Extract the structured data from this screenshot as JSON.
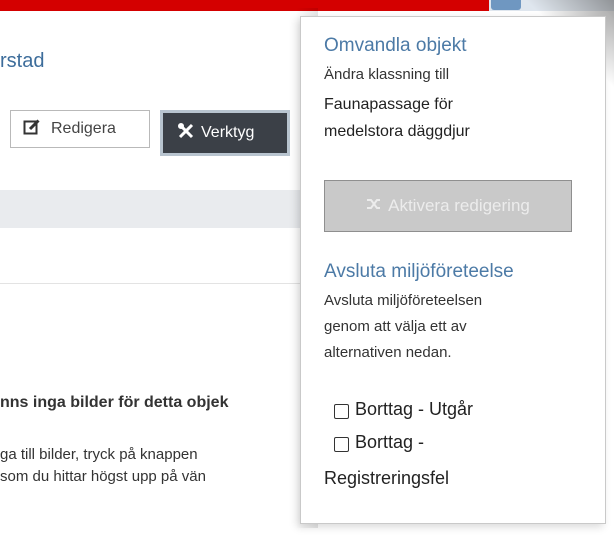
{
  "page": {
    "location_partial": "rstad",
    "edit_button_label": "Redigera",
    "tools_button_label": "Verktyg",
    "no_images_text": "nns inga bilder för detta objek",
    "hint_line1": "ga till bilder, tryck på knappen",
    "hint_line2": "som du hittar högst upp på vän"
  },
  "popover": {
    "convert_title": "Omvandla objekt",
    "convert_desc": "Ändra klassning till",
    "convert_class_line1": "Faunapassage för",
    "convert_class_line2": "medelstora däggdjur",
    "activate_button_label": "Aktivera redigering",
    "end_title": "Avsluta miljöföreteelse",
    "end_desc_line1": "Avsluta miljöföreteelsen",
    "end_desc_line2": "genom att välja ett av",
    "end_desc_line3": "alternativen nedan.",
    "options": [
      {
        "label": "Borttag - Utgår",
        "checked": false
      },
      {
        "label_line1": "Borttag -",
        "label_line2": "Registreringsfel",
        "checked": false
      }
    ]
  },
  "colors": {
    "top_bar": "#d40000",
    "link_blue": "#4c7aa6",
    "tools_button_bg": "#3b4047",
    "disabled_button_bg": "#c9c9c9"
  },
  "icons": {
    "edit": "edit-icon",
    "tools": "tools-icon",
    "activate": "shuffle-icon"
  }
}
